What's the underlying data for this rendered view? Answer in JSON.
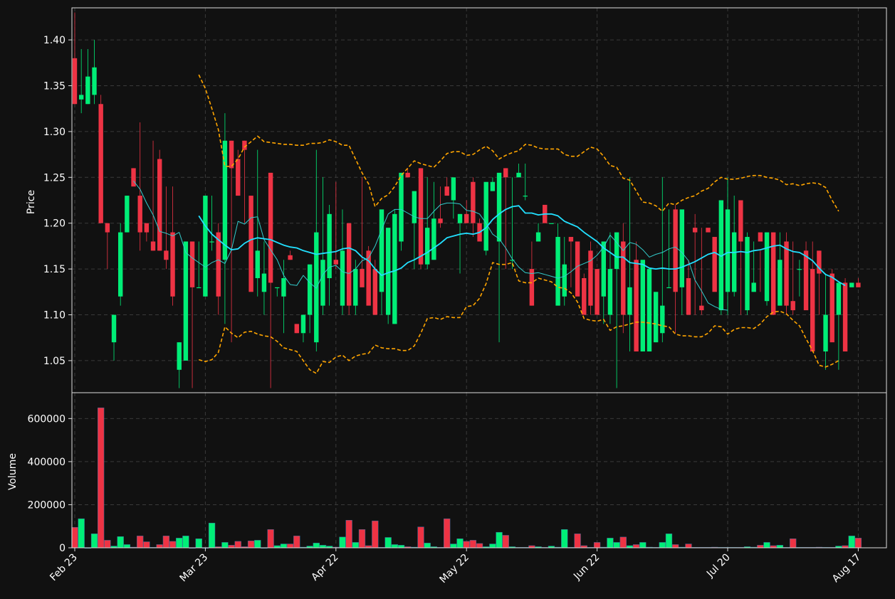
{
  "chart_data": {
    "type": "candlestick",
    "price_panel": {
      "ylabel": "Price",
      "ylim": [
        1.015,
        1.435
      ],
      "yticks": [
        "1.05",
        "1.10",
        "1.15",
        "1.20",
        "1.25",
        "1.30",
        "1.35",
        "1.40"
      ],
      "grid": true
    },
    "volume_panel": {
      "ylabel": "Volume",
      "ylim": [
        0,
        720000
      ],
      "yticks": [
        "0",
        "200000",
        "400000",
        "600000"
      ],
      "grid": true
    },
    "x_tick_labels": [
      "Feb 23",
      "Mar 23",
      "Apr 22",
      "May 22",
      "Jun 22",
      "Jul 20",
      "Aug 17"
    ],
    "x_tick_index": [
      0,
      20,
      40,
      60,
      80,
      100,
      120
    ],
    "colors": {
      "up": "#00ee77",
      "down": "#ee3344",
      "sma_fast": "#33cccc",
      "sma_slow": "#22e0ff",
      "bands": "#ffa500",
      "background": "#111111",
      "grid": "#3a3a3a"
    },
    "series": [
      {
        "name": "Candles",
        "open": [
          1.38,
          1.335,
          1.33,
          1.34,
          1.33,
          1.2,
          1.07,
          1.12,
          1.19,
          1.26,
          1.23,
          1.2,
          1.18,
          1.27,
          1.17,
          1.19,
          1.04,
          1.05,
          1.18,
          1.13,
          1.12,
          1.18,
          1.19,
          1.16,
          1.29,
          1.27,
          1.29,
          1.23,
          1.14,
          1.125,
          1.255,
          1.13,
          1.12,
          1.165,
          1.09,
          1.08,
          1.1,
          1.07,
          1.11,
          1.14,
          1.16,
          1.11,
          1.2,
          1.11,
          1.15,
          1.17,
          1.15,
          1.125,
          1.1,
          1.09,
          1.18,
          1.255,
          1.2,
          1.26,
          1.155,
          1.16,
          1.205,
          1.24,
          1.225,
          1.2,
          1.21,
          1.245,
          1.2,
          1.17,
          1.235,
          1.18,
          1.26,
          1.16,
          1.25,
          1.23,
          1.15,
          1.18,
          1.22,
          1.2,
          1.11,
          1.12,
          1.185,
          1.18,
          1.14,
          1.17,
          1.15,
          1.12,
          1.1,
          1.15,
          1.18,
          1.1,
          1.16,
          1.06,
          1.06,
          1.07,
          1.08,
          1.13,
          1.215,
          1.13,
          1.14,
          1.195,
          1.11,
          1.195,
          1.185,
          1.105,
          1.125,
          1.125,
          1.225,
          1.105,
          1.125,
          1.19,
          1.115,
          1.19,
          1.11,
          1.18,
          1.115,
          1.15,
          1.17,
          1.15,
          1.17,
          1.06,
          1.145,
          1.1,
          1.135,
          1.13,
          1.135
        ],
        "high": [
          1.43,
          1.39,
          1.39,
          1.4,
          1.34,
          1.2,
          1.1,
          1.2,
          1.23,
          1.26,
          1.31,
          1.2,
          1.29,
          1.28,
          1.24,
          1.24,
          1.07,
          1.18,
          1.18,
          1.18,
          1.23,
          1.23,
          1.2,
          1.32,
          1.29,
          1.28,
          1.29,
          1.23,
          1.28,
          1.18,
          1.255,
          1.13,
          1.16,
          1.17,
          1.09,
          1.08,
          1.1,
          1.28,
          1.25,
          1.22,
          1.245,
          1.215,
          1.2,
          1.16,
          1.25,
          1.175,
          1.16,
          1.13,
          1.1,
          1.215,
          1.21,
          1.26,
          1.22,
          1.26,
          1.25,
          1.245,
          1.24,
          1.25,
          1.24,
          1.21,
          1.225,
          1.25,
          1.205,
          1.2,
          1.25,
          1.19,
          1.26,
          1.25,
          1.265,
          1.265,
          1.18,
          1.2,
          1.22,
          1.2,
          1.2,
          1.185,
          1.18,
          1.18,
          1.145,
          1.18,
          1.15,
          1.12,
          1.19,
          1.19,
          1.2,
          1.25,
          1.18,
          1.07,
          1.07,
          1.09,
          1.25,
          1.215,
          1.22,
          1.13,
          1.16,
          1.21,
          1.195,
          1.195,
          1.185,
          1.105,
          1.25,
          1.23,
          1.225,
          1.19,
          1.18,
          1.17,
          1.17,
          1.19,
          1.19,
          1.19,
          1.18,
          1.16,
          1.18,
          1.18,
          1.17,
          1.145,
          1.15,
          1.1,
          1.14,
          1.13,
          1.14
        ],
        "low": [
          1.33,
          1.32,
          1.33,
          1.33,
          1.32,
          1.15,
          1.05,
          1.11,
          1.19,
          1.25,
          1.17,
          1.18,
          1.17,
          1.17,
          1.15,
          1.11,
          1.02,
          1.05,
          1.02,
          1.13,
          1.12,
          1.17,
          1.1,
          1.09,
          1.07,
          1.23,
          1.2,
          1.22,
          1.12,
          1.1,
          1.02,
          1.12,
          1.08,
          1.16,
          1.08,
          1.07,
          1.08,
          1.06,
          1.1,
          1.11,
          1.15,
          1.1,
          1.1,
          1.1,
          1.14,
          1.14,
          1.1,
          1.1,
          1.09,
          1.09,
          1.17,
          1.25,
          1.15,
          1.15,
          1.15,
          1.16,
          1.195,
          1.235,
          1.205,
          1.145,
          1.2,
          1.185,
          1.2,
          1.165,
          1.235,
          1.07,
          1.15,
          1.15,
          1.25,
          1.225,
          1.11,
          1.18,
          1.2,
          1.2,
          1.12,
          1.11,
          1.13,
          1.17,
          1.14,
          1.1,
          1.12,
          1.09,
          1.09,
          1.02,
          1.08,
          1.06,
          1.08,
          1.06,
          1.06,
          1.07,
          1.07,
          1.13,
          1.08,
          1.1,
          1.14,
          1.1,
          1.1,
          1.195,
          1.185,
          1.1,
          1.1,
          1.12,
          1.1,
          1.1,
          1.125,
          1.125,
          1.11,
          1.13,
          1.11,
          1.1,
          1.1,
          1.12,
          1.12,
          1.15,
          1.1,
          1.04,
          1.11,
          1.04,
          1.06,
          1.13,
          1.135
        ],
        "close": [
          1.33,
          1.34,
          1.36,
          1.37,
          1.2,
          1.19,
          1.1,
          1.19,
          1.23,
          1.24,
          1.19,
          1.19,
          1.17,
          1.17,
          1.16,
          1.12,
          1.07,
          1.18,
          1.13,
          1.13,
          1.23,
          1.18,
          1.12,
          1.29,
          1.26,
          1.23,
          1.28,
          1.125,
          1.17,
          1.145,
          1.135,
          1.13,
          1.14,
          1.16,
          1.08,
          1.1,
          1.155,
          1.19,
          1.16,
          1.21,
          1.155,
          1.17,
          1.11,
          1.15,
          1.13,
          1.11,
          1.1,
          1.215,
          1.195,
          1.21,
          1.255,
          1.25,
          1.235,
          1.155,
          1.195,
          1.205,
          1.2,
          1.23,
          1.25,
          1.21,
          1.2,
          1.2,
          1.18,
          1.245,
          1.245,
          1.255,
          1.25,
          1.16,
          1.255,
          1.23,
          1.11,
          1.19,
          1.2,
          1.2,
          1.185,
          1.155,
          1.18,
          1.12,
          1.1,
          1.11,
          1.1,
          1.18,
          1.15,
          1.19,
          1.1,
          1.13,
          1.06,
          1.16,
          1.15,
          1.125,
          1.11,
          1.13,
          1.125,
          1.215,
          1.1,
          1.19,
          1.105,
          1.19,
          1.125,
          1.225,
          1.215,
          1.19,
          1.18,
          1.185,
          1.135,
          1.18,
          1.19,
          1.1,
          1.16,
          1.11,
          1.105,
          1.15,
          1.105,
          1.06,
          1.145,
          1.1,
          1.07,
          1.135,
          1.06,
          1.135,
          1.13
        ],
        "volume": [
          95000,
          135000,
          0,
          65000,
          650000,
          35000,
          8000,
          52000,
          15000,
          3000,
          55000,
          28000,
          2000,
          15000,
          55000,
          30000,
          45000,
          55000,
          0,
          42000,
          0,
          115000,
          5000,
          25000,
          12000,
          30000,
          5000,
          32000,
          35000,
          0,
          85000,
          10000,
          18000,
          18000,
          55000,
          3000,
          8000,
          22000,
          12000,
          8000,
          3000,
          50000,
          128000,
          25000,
          85000,
          10000,
          125000,
          2000,
          48000,
          15000,
          12000,
          5000,
          3000,
          97000,
          22000,
          5000,
          2000,
          135000,
          18000,
          42000,
          30000,
          35000,
          20000,
          5000,
          18000,
          72000,
          58000,
          5000,
          2000,
          2000,
          10000,
          5000,
          2000,
          8000,
          3000,
          85000,
          2000,
          65000,
          10000,
          2000,
          25000,
          3000,
          45000,
          25000,
          50000,
          10000,
          15000,
          25000,
          3000,
          2000,
          25000,
          65000,
          15000,
          3000,
          18000,
          2000,
          2000,
          2000,
          3000,
          2000,
          2000,
          2000,
          2000,
          5000,
          3000,
          12000,
          25000,
          10000,
          12000,
          2000,
          42000,
          2000,
          2000,
          2000,
          3000,
          2000,
          2000,
          8000,
          10000,
          55000,
          45000,
          2000,
          108000,
          5000
        ]
      },
      {
        "name": "SMA fast",
        "start_index": 9,
        "values": [
          1.246,
          1.237,
          1.222,
          1.209,
          1.191,
          1.189,
          1.186,
          1.19,
          1.168,
          1.162,
          1.157,
          1.152,
          1.157,
          1.16,
          1.156,
          1.171,
          1.202,
          1.199,
          1.206,
          1.207,
          1.182,
          1.171,
          1.16,
          1.143,
          1.133,
          1.132,
          1.143,
          1.135,
          1.129,
          1.144,
          1.152,
          1.154,
          1.147,
          1.145,
          1.15,
          1.159,
          1.162,
          1.175,
          1.193,
          1.21,
          1.215,
          1.215,
          1.211,
          1.207,
          1.205,
          1.205,
          1.213,
          1.22,
          1.222,
          1.222,
          1.221,
          1.214,
          1.213,
          1.21,
          1.2,
          1.188,
          1.183,
          1.173,
          1.161,
          1.152,
          1.146,
          1.145,
          1.146,
          1.144,
          1.142,
          1.14,
          1.142,
          1.147,
          1.153,
          1.156,
          1.159,
          1.165,
          1.174,
          1.187,
          1.179,
          1.17,
          1.179,
          1.177,
          1.171,
          1.163,
          1.166,
          1.168,
          1.172,
          1.174,
          1.168,
          1.159,
          1.138,
          1.126,
          1.113,
          1.109,
          1.106,
          1.105
        ]
      },
      {
        "name": "SMA slow",
        "start_index": 19,
        "values": [
          1.208,
          1.197,
          1.188,
          1.182,
          1.176,
          1.171,
          1.172,
          1.178,
          1.182,
          1.184,
          1.183,
          1.182,
          1.179,
          1.176,
          1.174,
          1.173,
          1.17,
          1.168,
          1.166,
          1.167,
          1.168,
          1.169,
          1.172,
          1.173,
          1.17,
          1.163,
          1.159,
          1.15,
          1.143,
          1.146,
          1.148,
          1.151,
          1.157,
          1.16,
          1.164,
          1.168,
          1.173,
          1.178,
          1.184,
          1.186,
          1.188,
          1.189,
          1.188,
          1.19,
          1.195,
          1.204,
          1.21,
          1.215,
          1.218,
          1.219,
          1.211,
          1.211,
          1.209,
          1.21,
          1.21,
          1.208,
          1.202,
          1.199,
          1.196,
          1.19,
          1.185,
          1.18,
          1.173,
          1.168,
          1.163,
          1.163,
          1.157,
          1.156,
          1.155,
          1.151,
          1.15,
          1.151,
          1.15,
          1.15,
          1.152,
          1.155,
          1.158,
          1.162,
          1.166,
          1.168,
          1.164,
          1.168,
          1.168,
          1.169,
          1.168,
          1.17,
          1.171,
          1.173,
          1.175,
          1.176,
          1.172,
          1.169,
          1.168,
          1.164,
          1.159,
          1.151,
          1.144,
          1.141,
          1.136,
          1.132
        ]
      },
      {
        "name": "Upper band",
        "start_index": 19,
        "values": [
          1.362,
          1.347,
          1.325,
          1.302,
          1.262,
          1.262,
          1.27,
          1.283,
          1.289,
          1.295,
          1.289,
          1.288,
          1.287,
          1.286,
          1.286,
          1.285,
          1.285,
          1.287,
          1.287,
          1.288,
          1.291,
          1.289,
          1.285,
          1.285,
          1.27,
          1.255,
          1.243,
          1.218,
          1.227,
          1.231,
          1.24,
          1.252,
          1.26,
          1.268,
          1.265,
          1.263,
          1.261,
          1.268,
          1.276,
          1.278,
          1.278,
          1.274,
          1.275,
          1.28,
          1.284,
          1.279,
          1.27,
          1.274,
          1.277,
          1.279,
          1.286,
          1.285,
          1.282,
          1.281,
          1.281,
          1.281,
          1.275,
          1.273,
          1.273,
          1.278,
          1.283,
          1.281,
          1.273,
          1.263,
          1.261,
          1.249,
          1.247,
          1.235,
          1.223,
          1.222,
          1.219,
          1.213,
          1.222,
          1.22,
          1.225,
          1.228,
          1.23,
          1.235,
          1.238,
          1.245,
          1.25,
          1.248,
          1.248,
          1.249,
          1.251,
          1.252,
          1.252,
          1.25,
          1.249,
          1.247,
          1.242,
          1.243,
          1.241,
          1.243,
          1.244,
          1.243,
          1.239,
          1.225,
          1.213
        ]
      },
      {
        "name": "Lower band",
        "start_index": 19,
        "values": [
          1.051,
          1.049,
          1.051,
          1.059,
          1.087,
          1.08,
          1.075,
          1.081,
          1.082,
          1.079,
          1.077,
          1.076,
          1.071,
          1.064,
          1.062,
          1.06,
          1.05,
          1.04,
          1.036,
          1.049,
          1.048,
          1.054,
          1.056,
          1.05,
          1.055,
          1.057,
          1.058,
          1.067,
          1.064,
          1.063,
          1.063,
          1.061,
          1.061,
          1.066,
          1.08,
          1.096,
          1.097,
          1.095,
          1.098,
          1.097,
          1.097,
          1.109,
          1.11,
          1.118,
          1.134,
          1.157,
          1.155,
          1.155,
          1.157,
          1.137,
          1.135,
          1.135,
          1.14,
          1.138,
          1.136,
          1.13,
          1.129,
          1.124,
          1.114,
          1.096,
          1.094,
          1.093,
          1.095,
          1.083,
          1.087,
          1.088,
          1.09,
          1.092,
          1.092,
          1.091,
          1.09,
          1.088,
          1.087,
          1.079,
          1.077,
          1.077,
          1.076,
          1.076,
          1.08,
          1.088,
          1.087,
          1.079,
          1.084,
          1.086,
          1.086,
          1.085,
          1.09,
          1.098,
          1.103,
          1.104,
          1.101,
          1.094,
          1.088,
          1.074,
          1.061,
          1.045,
          1.043,
          1.046,
          1.05
        ]
      }
    ]
  }
}
